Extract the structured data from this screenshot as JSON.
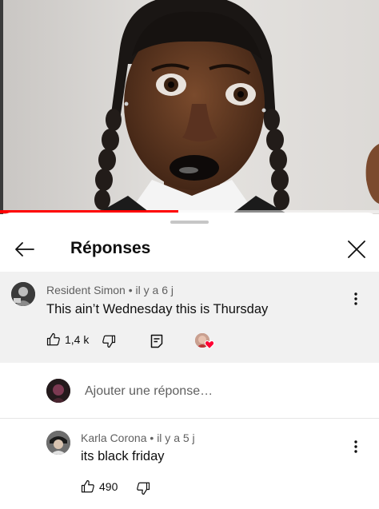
{
  "video": {
    "progress_percent": 47
  },
  "sheet": {
    "title": "Réponses",
    "back_icon": "arrow-left-icon",
    "close_icon": "close-icon"
  },
  "parent_comment": {
    "author": "Resident Simon",
    "time": "il y a 6 j",
    "text": "This ain’t Wednesday this is Thursday",
    "likes": "1,4 k",
    "creator_heart": true
  },
  "reply_box": {
    "placeholder": "Ajouter une réponse…"
  },
  "replies": [
    {
      "author": "Karla Corona",
      "time": "il y a 5 j",
      "text": "its black friday",
      "likes": "490"
    }
  ],
  "colors": {
    "accent_red": "#ff0000",
    "meta_gray": "#606060",
    "highlight_bg": "#f1f1f1"
  }
}
